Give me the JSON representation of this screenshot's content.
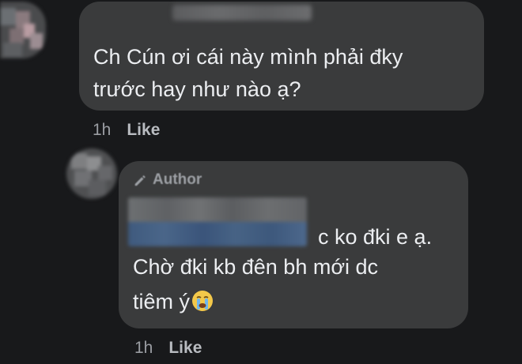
{
  "comments": [
    {
      "author_badge": "",
      "text_lines": [
        "Ch Cún ơi cái này mình phải đky",
        "trước hay như nào ạ?"
      ],
      "time": "1h",
      "like_label": "Like"
    },
    {
      "author_badge": "Author",
      "text_lines": [
        "c ko đki e ạ.",
        "Chờ đki kb đên bh mới dc",
        "tiêm ý"
      ],
      "emoji": "crying-face-icon",
      "time": "1h",
      "like_label": "Like"
    }
  ],
  "colors": {
    "background": "#18191b",
    "bubble": "#3a3b3c",
    "text": "#eceef1",
    "meta_text": "#b0b3b8"
  }
}
